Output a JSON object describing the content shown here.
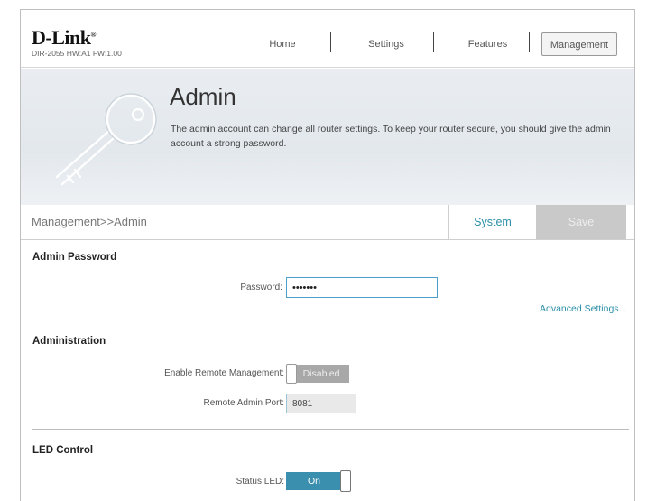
{
  "brand": {
    "logo_text": "D-Link",
    "model_info": "DIR-2055 HW:A1 FW:1.00"
  },
  "nav": {
    "home": "Home",
    "settings": "Settings",
    "features": "Features",
    "management": "Management",
    "active": "Management"
  },
  "banner": {
    "title": "Admin",
    "description": "The admin account can change all router settings. To keep your router secure, you should give the admin account a strong password."
  },
  "breadcrumb": "Management>>Admin",
  "tabs": {
    "system": "System",
    "save": "Save"
  },
  "admin_password": {
    "title": "Admin Password",
    "password_label": "Password:",
    "password_value": "•••••••",
    "advanced_link": "Advanced Settings..."
  },
  "administration": {
    "title": "Administration",
    "remote_mgmt_label": "Enable Remote Management:",
    "remote_mgmt_state": "Disabled",
    "remote_port_label": "Remote Admin Port:",
    "remote_port_value": "8081"
  },
  "led_control": {
    "title": "LED Control",
    "status_led_label": "Status LED:",
    "status_led_state": "On"
  },
  "colors": {
    "accent": "#3a8fae",
    "link": "#2b8fa8",
    "banner_bg": "#e6ebf0",
    "save_disabled": "#c9c9c9"
  },
  "icons": {
    "banner_icon": "key-icon"
  }
}
